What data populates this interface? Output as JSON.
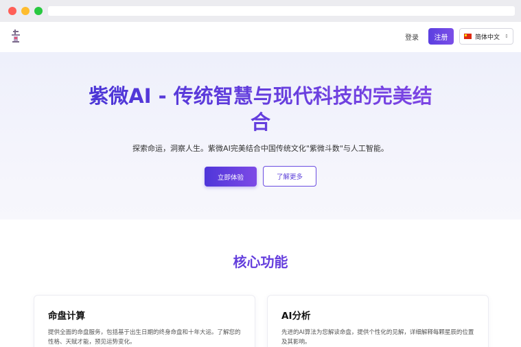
{
  "nav": {
    "login": "登录",
    "signup": "注册",
    "language": "简体中文"
  },
  "hero": {
    "title": "紫微AI - 传统智慧与现代科技的完美结合",
    "subtitle": "探索命运，洞察人生。紫微AI完美结合中国传统文化\"紫微斗数\"与人工智能。",
    "primary_button": "立即体验",
    "secondary_button": "了解更多"
  },
  "features": {
    "title": "核心功能",
    "cards": [
      {
        "title": "命盘计算",
        "description": "提供全面的命盘服务，包括基于出生日期的终身命盘和十年大运。了解您的性格、天赋才能，预见运势变化。"
      },
      {
        "title": "AI分析",
        "description": "先进的AI算法为您解读命盘，提供个性化的见解，详细解释每颗星辰的位置及其影响。"
      }
    ]
  },
  "colors": {
    "accent": "#5b35d8",
    "accent_light": "#7e46e4"
  }
}
